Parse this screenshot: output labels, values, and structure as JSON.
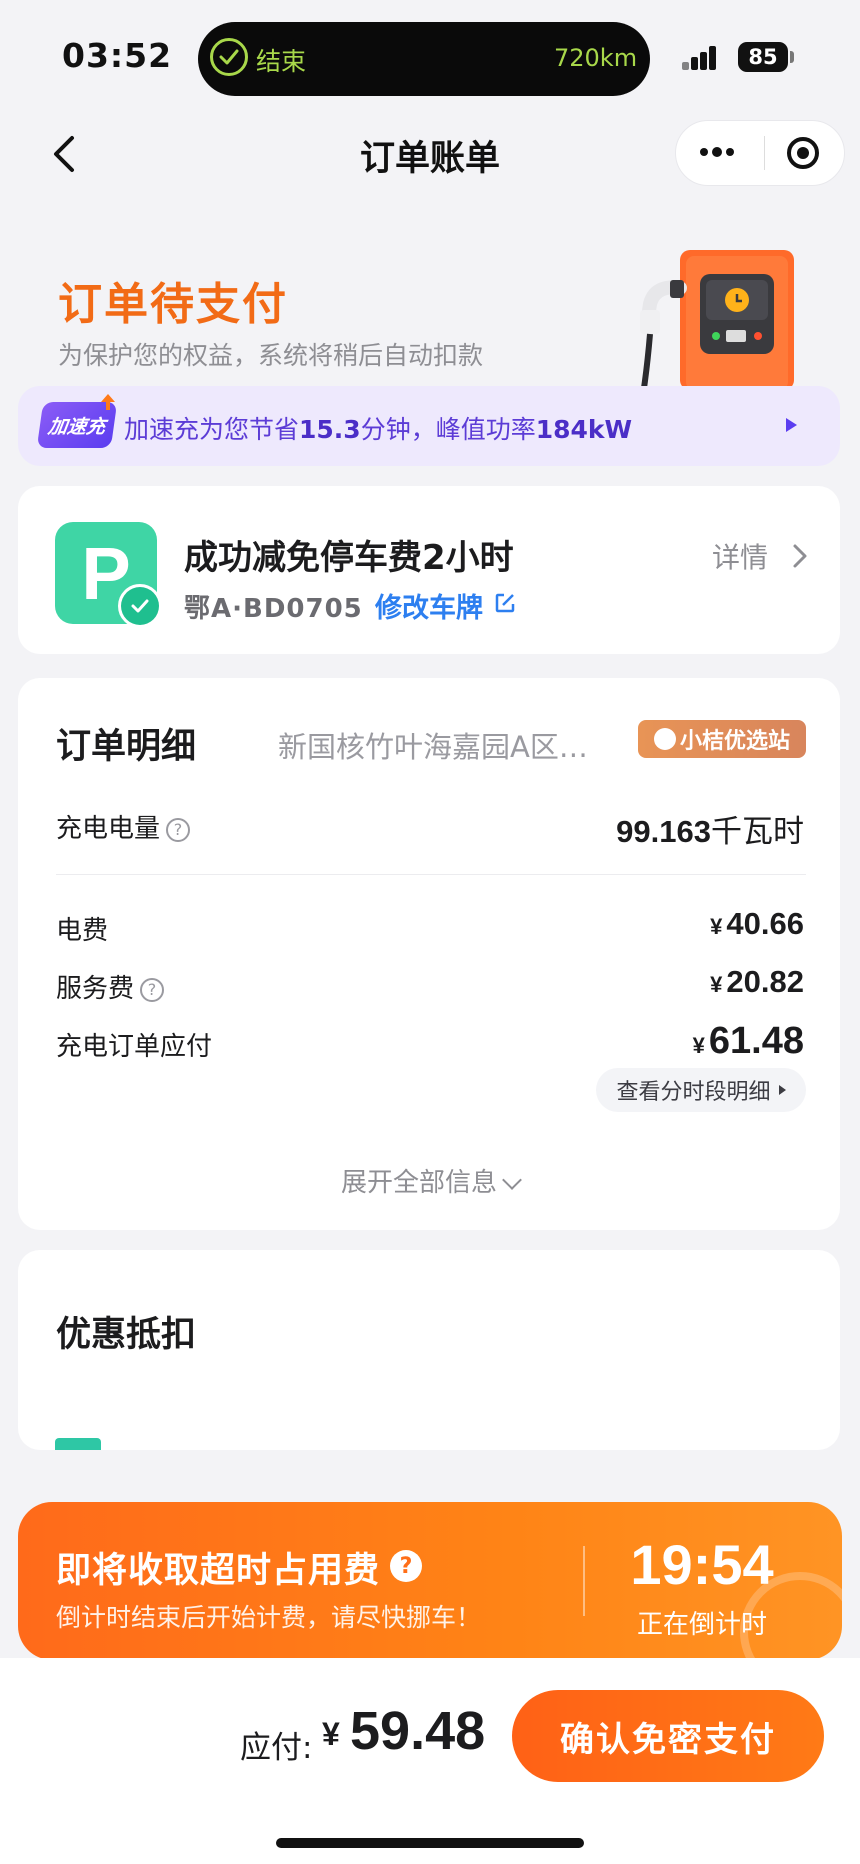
{
  "status_bar": {
    "time": "03:52",
    "island_label": "结束",
    "island_range": "720km",
    "battery": "85"
  },
  "nav": {
    "title": "订单账单"
  },
  "order_status": {
    "title": "订单待支付",
    "subtitle": "为保护您的权益，系统将稍后自动扣款"
  },
  "boost": {
    "badge": "加速充",
    "text_prefix": "加速充为您节省",
    "minutes": "15.3",
    "text_mid": "分钟，峰值功率",
    "power": "184kW"
  },
  "parking": {
    "icon_letter": "P",
    "title": "成功减免停车费2小时",
    "plate": "鄂A·BD0705",
    "edit_label": "修改车牌",
    "detail_label": "详情"
  },
  "order_detail": {
    "title": "订单明细",
    "station": "新国核竹叶海嘉园A区…",
    "station_badge": "小桔优选站",
    "energy_label": "充电电量",
    "energy_value": "99.163",
    "energy_unit": "千瓦时",
    "rows": [
      {
        "label": "电费",
        "value": "40.66"
      },
      {
        "label": "服务费",
        "value": "20.82"
      },
      {
        "label": "充电订单应付",
        "value": "61.48"
      }
    ],
    "currency": "¥",
    "period_button": "查看分时段明细",
    "expand_label": "展开全部信息"
  },
  "discount": {
    "title": "优惠抵扣"
  },
  "overtime": {
    "title": "即将收取超时占用费",
    "subtitle": "倒计时结束后开始计费，请尽快挪车！",
    "countdown": "19:54",
    "countdown_label": "正在倒计时"
  },
  "payment": {
    "label": "应付:",
    "currency": "¥",
    "amount": "59.48",
    "button": "确认免密支付"
  },
  "colors": {
    "accent_orange": "#f26b16",
    "boost_purple": "#5c3cd6",
    "parking_green": "#3fd5a5",
    "link_blue": "#2d7ff0"
  }
}
